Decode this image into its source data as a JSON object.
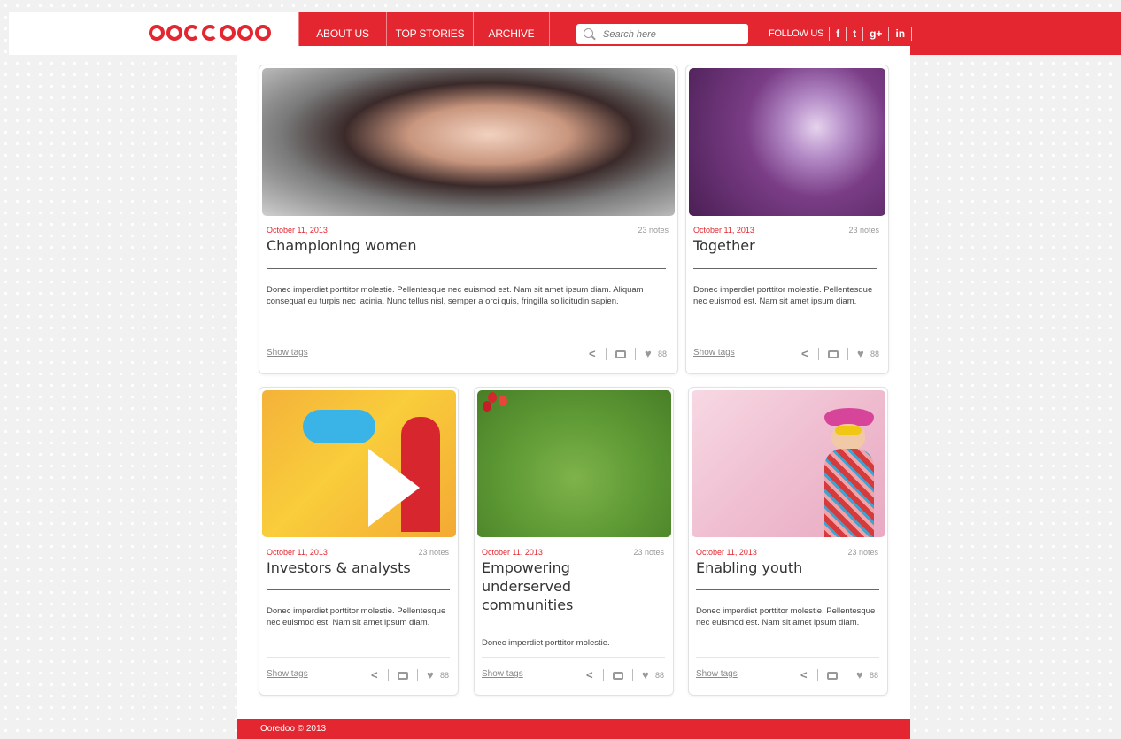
{
  "header": {
    "logo_text": "ooredoo",
    "nav": [
      "ABOUT US",
      "TOP STORIES",
      "ARCHIVE"
    ],
    "search_placeholder": "Search here",
    "follow_label": "FOLLOW US",
    "social": [
      "f",
      "t",
      "g+",
      "in"
    ]
  },
  "colors": {
    "brand": "#e3262f",
    "text": "#333333",
    "muted": "#999999"
  },
  "cards": [
    {
      "date": "October 11, 2013",
      "notes": "23 notes",
      "title": "Championing women",
      "body": "Donec imperdiet porttitor molestie. Pellentesque nec euismod est. Nam sit amet ipsum diam. Aliquam consequat eu turpis nec lacinia. Nunc tellus nisl, semper a orci quis, fringilla sollicitudin sapien.",
      "tags": "Show tags",
      "likes": "88"
    },
    {
      "date": "October 11, 2013",
      "notes": "23 notes",
      "title": "Together",
      "body": "Donec imperdiet porttitor molestie. Pellentesque nec euismod est. Nam sit amet ipsum diam.",
      "tags": "Show tags",
      "likes": "88"
    },
    {
      "date": "October 11, 2013",
      "notes": "23 notes",
      "title": "Investors & analysts",
      "body": "Donec imperdiet porttitor molestie. Pellentesque nec euismod est. Nam sit amet ipsum diam.",
      "tags": "Show tags",
      "likes": "88"
    },
    {
      "date": "October 11, 2013",
      "notes": "23 notes",
      "title": "Empowering underserved communities",
      "body": "Donec imperdiet porttitor molestie.",
      "tags": "Show tags",
      "likes": "88"
    },
    {
      "date": "October 11, 2013",
      "notes": "23 notes",
      "title": "Enabling youth",
      "body": "Donec imperdiet porttitor molestie. Pellentesque nec euismod est. Nam sit amet ipsum diam.",
      "tags": "Show tags",
      "likes": "88"
    }
  ],
  "footer": {
    "text": "Ooredoo © 2013"
  }
}
